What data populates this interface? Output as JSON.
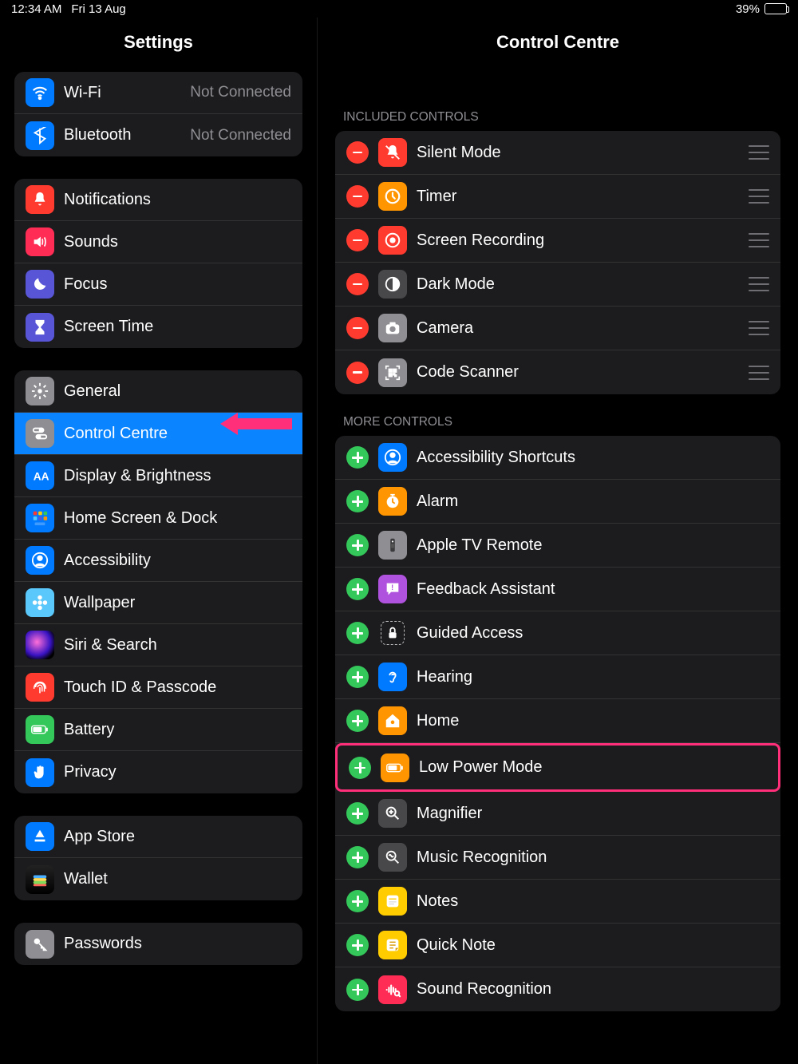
{
  "status": {
    "time": "12:34 AM",
    "date": "Fri 13 Aug",
    "battery_pct": "39%"
  },
  "sidebar": {
    "title": "Settings",
    "groups": [
      [
        {
          "label": "Wi-Fi",
          "value": "Not Connected",
          "icon": "wifi",
          "color": "blue"
        },
        {
          "label": "Bluetooth",
          "value": "Not Connected",
          "icon": "bluetooth",
          "color": "blue"
        }
      ],
      [
        {
          "label": "Notifications",
          "icon": "bell",
          "color": "red"
        },
        {
          "label": "Sounds",
          "icon": "speaker",
          "color": "coral"
        },
        {
          "label": "Focus",
          "icon": "moon",
          "color": "purple"
        },
        {
          "label": "Screen Time",
          "icon": "hourglass",
          "color": "purple"
        }
      ],
      [
        {
          "label": "General",
          "icon": "gear",
          "color": "grey"
        },
        {
          "label": "Control Centre",
          "icon": "switches",
          "color": "grey",
          "selected": true,
          "arrow": true
        },
        {
          "label": "Display & Brightness",
          "icon": "aa",
          "color": "blue"
        },
        {
          "label": "Home Screen & Dock",
          "icon": "apps",
          "color": "blue"
        },
        {
          "label": "Accessibility",
          "icon": "person",
          "color": "blue"
        },
        {
          "label": "Wallpaper",
          "icon": "flower",
          "color": "cyan"
        },
        {
          "label": "Siri & Search",
          "icon": "siri",
          "color": "siri"
        },
        {
          "label": "Touch ID & Passcode",
          "icon": "fingerprint",
          "color": "red"
        },
        {
          "label": "Battery",
          "icon": "battery",
          "color": "green"
        },
        {
          "label": "Privacy",
          "icon": "hand",
          "color": "blue"
        }
      ],
      [
        {
          "label": "App Store",
          "icon": "appstore",
          "color": "blue"
        },
        {
          "label": "Wallet",
          "icon": "wallet",
          "color": "wallet"
        }
      ],
      [
        {
          "label": "Passwords",
          "icon": "key",
          "color": "grey"
        }
      ]
    ]
  },
  "main": {
    "title": "Control Centre",
    "sections": [
      {
        "header": "INCLUDED CONTROLS",
        "action": "remove",
        "drag": true,
        "items": [
          {
            "label": "Silent Mode",
            "icon": "bell_slash",
            "color": "red"
          },
          {
            "label": "Timer",
            "icon": "timer",
            "color": "orange"
          },
          {
            "label": "Screen Recording",
            "icon": "record",
            "color": "red"
          },
          {
            "label": "Dark Mode",
            "icon": "halfcircle",
            "color": "darkgrey"
          },
          {
            "label": "Camera",
            "icon": "camera",
            "color": "grey"
          },
          {
            "label": "Code Scanner",
            "icon": "qr",
            "color": "grey"
          }
        ]
      },
      {
        "header": "MORE CONTROLS",
        "action": "add",
        "drag": false,
        "items": [
          {
            "label": "Accessibility Shortcuts",
            "icon": "person",
            "color": "blue"
          },
          {
            "label": "Alarm",
            "icon": "clock",
            "color": "orange"
          },
          {
            "label": "Apple TV Remote",
            "icon": "remote",
            "color": "grey"
          },
          {
            "label": "Feedback Assistant",
            "icon": "feedback",
            "color": "purple2"
          },
          {
            "label": "Guided Access",
            "icon": "lock_dashed",
            "color": "dashed"
          },
          {
            "label": "Hearing",
            "icon": "ear",
            "color": "blue"
          },
          {
            "label": "Home",
            "icon": "home",
            "color": "orange"
          },
          {
            "label": "Low Power Mode",
            "icon": "battery",
            "color": "orange",
            "highlight": true
          },
          {
            "label": "Magnifier",
            "icon": "search_plus",
            "color": "darkgrey"
          },
          {
            "label": "Music Recognition",
            "icon": "search_wave",
            "color": "darkgrey"
          },
          {
            "label": "Notes",
            "icon": "notes",
            "color": "yellow"
          },
          {
            "label": "Quick Note",
            "icon": "quicknote",
            "color": "yellow"
          },
          {
            "label": "Sound Recognition",
            "icon": "sound_rec",
            "color": "coral"
          }
        ]
      }
    ]
  }
}
